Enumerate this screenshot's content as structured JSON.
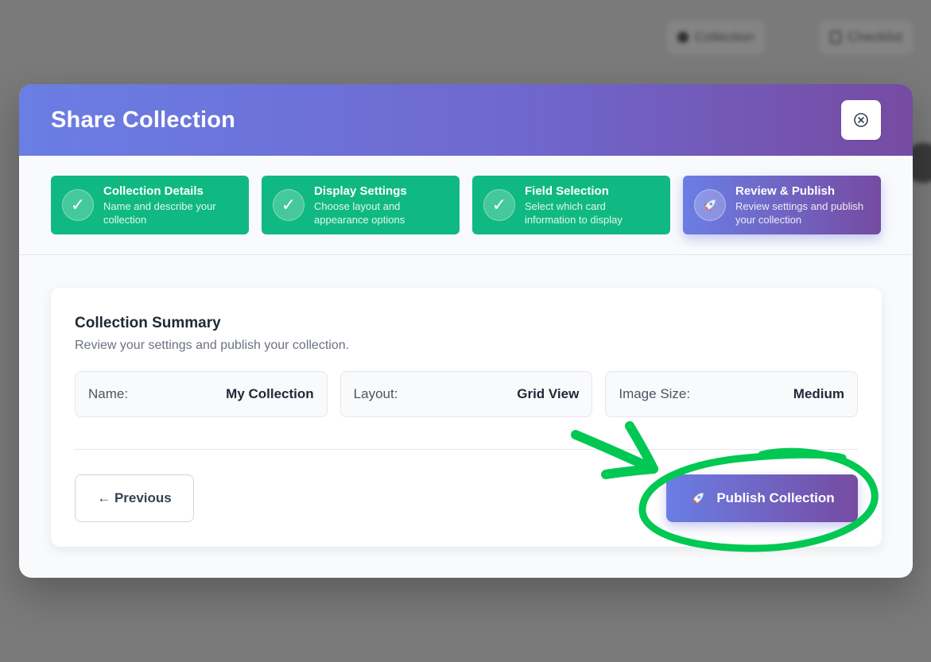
{
  "background": {
    "pills": [
      {
        "label": "Collection",
        "icon": "circle-icon"
      },
      {
        "label": "Checklist",
        "icon": "checklist-icon"
      }
    ]
  },
  "modal": {
    "title": "Share Collection",
    "close_icon": "close-circle-icon"
  },
  "steps": [
    {
      "title": "Collection Details",
      "description": "Name and describe your collection",
      "status": "complete",
      "icon": "✓"
    },
    {
      "title": "Display Settings",
      "description": "Choose layout and appearance options",
      "status": "complete",
      "icon": "✓"
    },
    {
      "title": "Field Selection",
      "description": "Select which card information to display",
      "status": "complete",
      "icon": "✓"
    },
    {
      "title": "Review & Publish",
      "description": "Review settings and publish your collection",
      "status": "active",
      "icon": "rocket-icon"
    }
  ],
  "summary": {
    "title": "Collection Summary",
    "subtitle": "Review your settings and publish your collection.",
    "items": [
      {
        "label": "Name:",
        "value": "My Collection"
      },
      {
        "label": "Layout:",
        "value": "Grid View"
      },
      {
        "label": "Image Size:",
        "value": "Medium"
      }
    ]
  },
  "actions": {
    "previous_label": "← Previous",
    "publish_label": "Publish Collection",
    "publish_icon": "rocket-icon"
  },
  "colors": {
    "accent_start": "#667eea",
    "accent_end": "#764ba2",
    "step_complete": "#10b981",
    "annotation": "#00c853"
  }
}
